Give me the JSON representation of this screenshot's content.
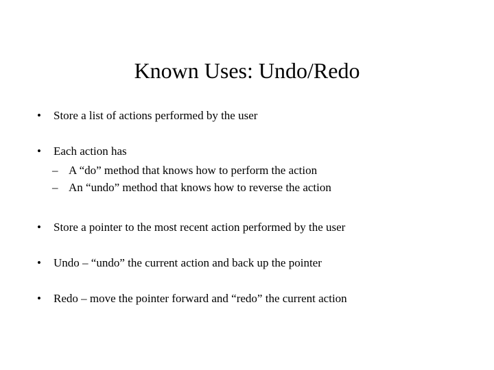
{
  "slide": {
    "title": "Known Uses: Undo/Redo",
    "bullets": [
      {
        "text": "Store a list of actions performed by the user",
        "sub": []
      },
      {
        "text": "Each action has",
        "sub": [
          "A “do” method that knows how to perform the action",
          "An “undo” method that knows how to reverse the action"
        ]
      },
      {
        "text": "Store a pointer to the most recent action performed by the user",
        "sub": []
      },
      {
        "text": "Undo – “undo” the current action and back up the pointer",
        "sub": []
      },
      {
        "text": "Redo – move the pointer forward and “redo” the current action",
        "sub": []
      }
    ]
  }
}
